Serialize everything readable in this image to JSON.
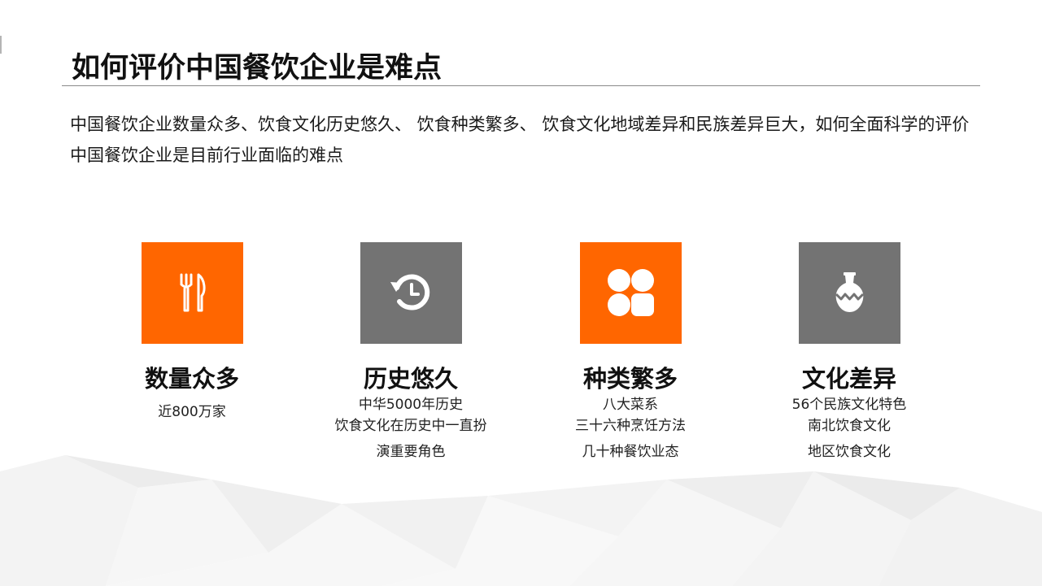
{
  "slide": {
    "title": "如何评价中国餐饮企业是难点",
    "intro": "中国餐饮企业数量众多、饮食文化历史悠久、 饮食种类繁多、 饮食文化地域差异和民族差异巨大，如何全面科学的评价中国餐饮企业是目前行业面临的难点"
  },
  "colors": {
    "accent": "#ff6600",
    "neutral": "#737373"
  },
  "cards": [
    {
      "icon": "fork-knife-icon",
      "color": "orange",
      "heading": "数量众多",
      "lines": [
        "近800万家"
      ]
    },
    {
      "icon": "history-clock-icon",
      "color": "gray",
      "heading": "历史悠久",
      "lines": [
        "中华5000年历史",
        "饮食文化在历史中一直扮",
        "演重要角色"
      ]
    },
    {
      "icon": "four-grid-icon",
      "color": "orange",
      "heading": "种类繁多",
      "lines": [
        "八大菜系",
        "三十六种烹饪方法",
        "几十种餐饮业态"
      ]
    },
    {
      "icon": "vase-icon",
      "color": "gray",
      "heading": "文化差异",
      "lines": [
        "56个民族文化特色",
        "南北饮食文化",
        "地区饮食文化"
      ]
    }
  ]
}
